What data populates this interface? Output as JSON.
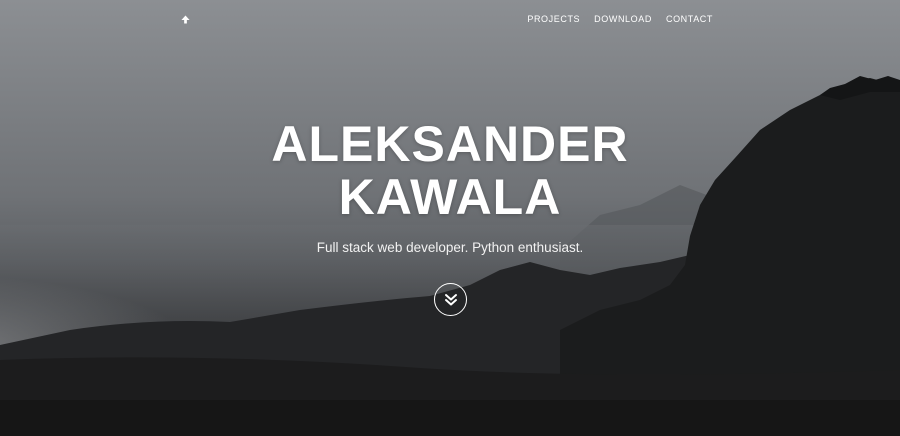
{
  "nav": {
    "brand_icon": "arrow-up-icon",
    "links": [
      {
        "label": "PROJECTS"
      },
      {
        "label": "DOWNLOAD"
      },
      {
        "label": "CONTACT"
      }
    ]
  },
  "hero": {
    "title_line1": "ALEKSANDER",
    "title_line2": "KAWALA",
    "subtitle": "Full stack web developer. Python enthusiast.",
    "scroll_icon": "double-chevron-down-icon"
  },
  "colors": {
    "text": "#ffffff",
    "sky": "#8c8f93",
    "ground": "#161616"
  }
}
